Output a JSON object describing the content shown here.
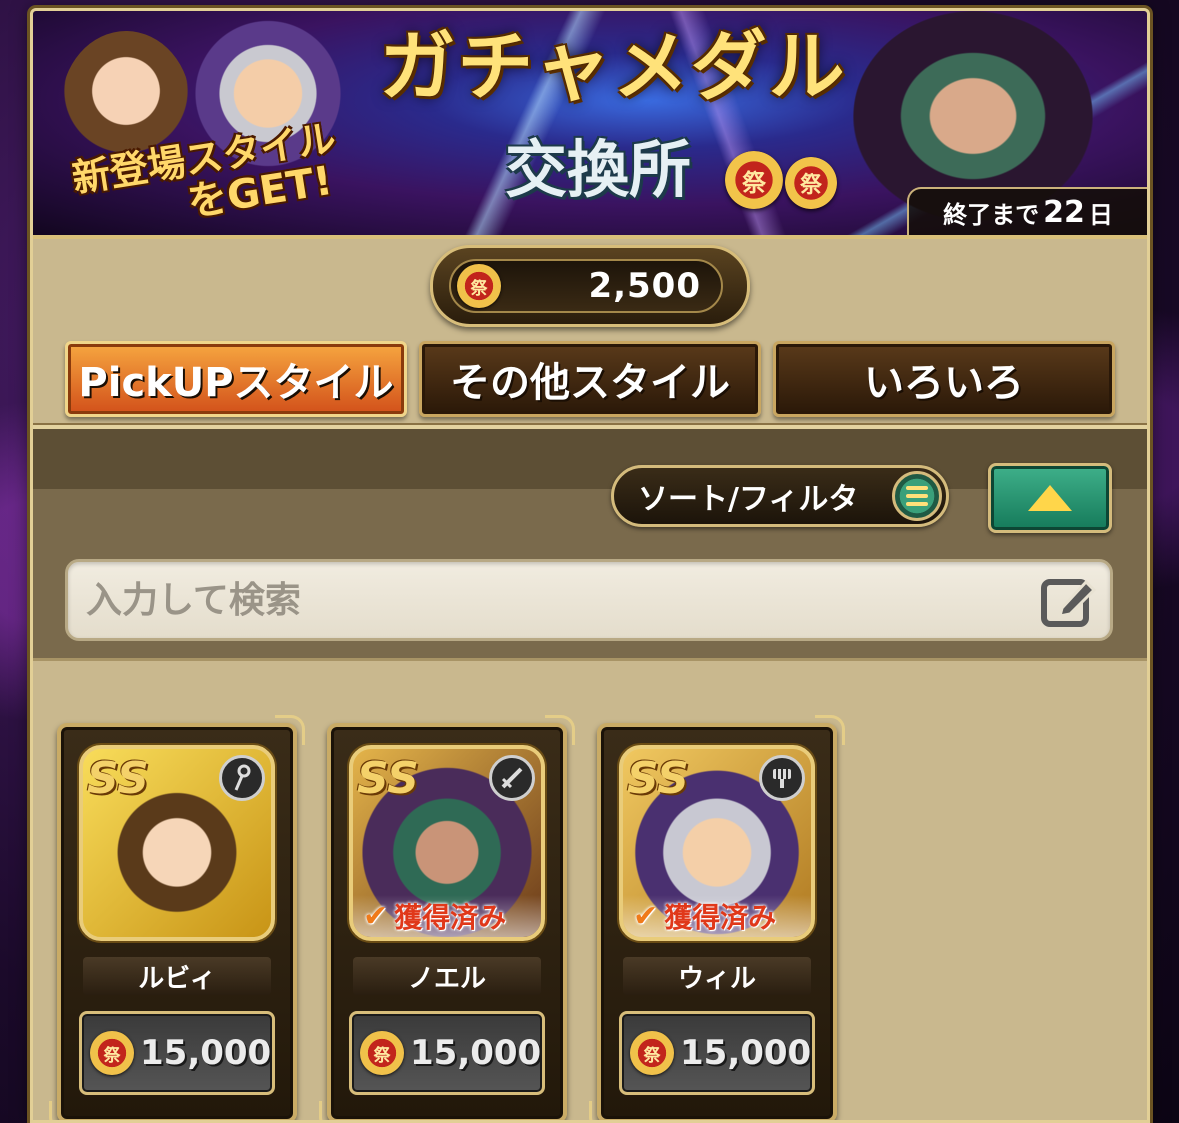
{
  "banner": {
    "badge_line1": "新登場スタイル",
    "badge_line2": "をGET!",
    "title": "ガチャメダル",
    "subtitle": "交換所",
    "medal_glyph": "祭",
    "countdown_prefix": "終了まで",
    "countdown_days": "22",
    "countdown_unit": "日"
  },
  "currency": {
    "icon": "festival-medal-icon",
    "glyph": "祭",
    "amount": "2,500"
  },
  "tabs": [
    {
      "label": "PickUPスタイル",
      "active": true
    },
    {
      "label": "その他スタイル",
      "active": false
    },
    {
      "label": "いろいろ",
      "active": false
    }
  ],
  "filter": {
    "sort_label": "ソート/フィルタ",
    "search_placeholder": "入力して検索"
  },
  "cards": [
    {
      "rarity": "SS",
      "name": "ルビィ",
      "price": "15,000",
      "obtained": false,
      "weapon": "staff-icon"
    },
    {
      "rarity": "SS",
      "name": "ノエル",
      "price": "15,000",
      "obtained": true,
      "obtained_label": "獲得済み",
      "weapon": "sword-icon"
    },
    {
      "rarity": "SS",
      "name": "ウィル",
      "price": "15,000",
      "obtained": true,
      "obtained_label": "獲得済み",
      "weapon": "fist-icon"
    }
  ],
  "colors": {
    "accent_orange": "#d2501a",
    "accent_green": "#157a5a",
    "gold_trim": "#d7bd7a",
    "obtained_red": "#e0381a"
  }
}
